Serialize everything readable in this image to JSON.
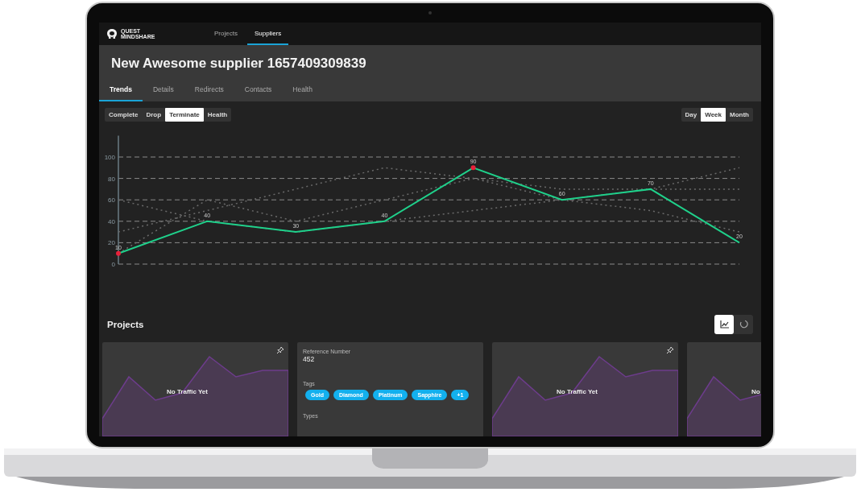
{
  "brand": {
    "line1": "QUEST",
    "line2": "MINDSHARE"
  },
  "nav": [
    {
      "label": "Projects",
      "selected": false
    },
    {
      "label": "Suppliers",
      "selected": true
    }
  ],
  "title": "New Awesome supplier 1657409309839",
  "tabs": [
    {
      "label": "Trends",
      "selected": true
    },
    {
      "label": "Details",
      "selected": false
    },
    {
      "label": "Redirects",
      "selected": false
    },
    {
      "label": "Contacts",
      "selected": false
    },
    {
      "label": "Health",
      "selected": false
    }
  ],
  "metric_buttons": [
    {
      "label": "Complete",
      "selected": false
    },
    {
      "label": "Drop",
      "selected": false
    },
    {
      "label": "Terminate",
      "selected": true
    },
    {
      "label": "Health",
      "selected": false
    }
  ],
  "period_buttons": [
    {
      "label": "Day",
      "selected": false
    },
    {
      "label": "Week",
      "selected": true
    },
    {
      "label": "Month",
      "selected": false
    }
  ],
  "chart_data": {
    "type": "line",
    "ylim": [
      0,
      120
    ],
    "yticks": [
      0,
      20,
      40,
      60,
      80,
      100
    ],
    "grid": true,
    "series": [
      {
        "color": "#1fd18b",
        "line_style": "solid",
        "values": [
          10,
          40,
          30,
          40,
          90,
          60,
          70,
          20
        ],
        "value_labels": [
          "10",
          "40",
          "30",
          "40",
          "90",
          "60",
          "70",
          "20"
        ]
      },
      {
        "color": "#6a6a6a",
        "line_style": "dotted",
        "values": [
          30,
          50,
          70,
          90,
          80,
          70,
          70,
          70
        ],
        "value_labels": [
          null,
          null,
          null,
          null,
          null,
          null,
          null,
          null
        ]
      },
      {
        "color": "#6a6a6a",
        "line_style": "dotted",
        "values": [
          60,
          40,
          30,
          40,
          50,
          60,
          70,
          90
        ],
        "value_labels": [
          null,
          null,
          null,
          null,
          null,
          null,
          null,
          null
        ]
      },
      {
        "color": "#6a6a6a",
        "line_style": "dotted",
        "values": [
          10,
          60,
          40,
          60,
          80,
          60,
          50,
          30
        ],
        "value_labels": [
          null,
          null,
          null,
          null,
          null,
          null,
          null,
          null
        ]
      }
    ]
  },
  "projects": {
    "title": "Projects",
    "view_toggle": [
      {
        "kind": "chart",
        "selected": true
      },
      {
        "kind": "loading",
        "selected": false
      }
    ],
    "cards": [
      {
        "kind": "traffic",
        "message": "No Traffic Yet"
      },
      {
        "kind": "info",
        "fields": [
          {
            "label": "Reference Number",
            "value": "452"
          },
          {
            "label": "Tags",
            "tags": [
              "Gold",
              "Diamond",
              "Platinum",
              "Sapphire",
              "+1"
            ]
          },
          {
            "label": "Types"
          }
        ]
      },
      {
        "kind": "traffic",
        "message": "No Traffic Yet"
      },
      {
        "kind": "traffic",
        "message": "No"
      }
    ]
  }
}
